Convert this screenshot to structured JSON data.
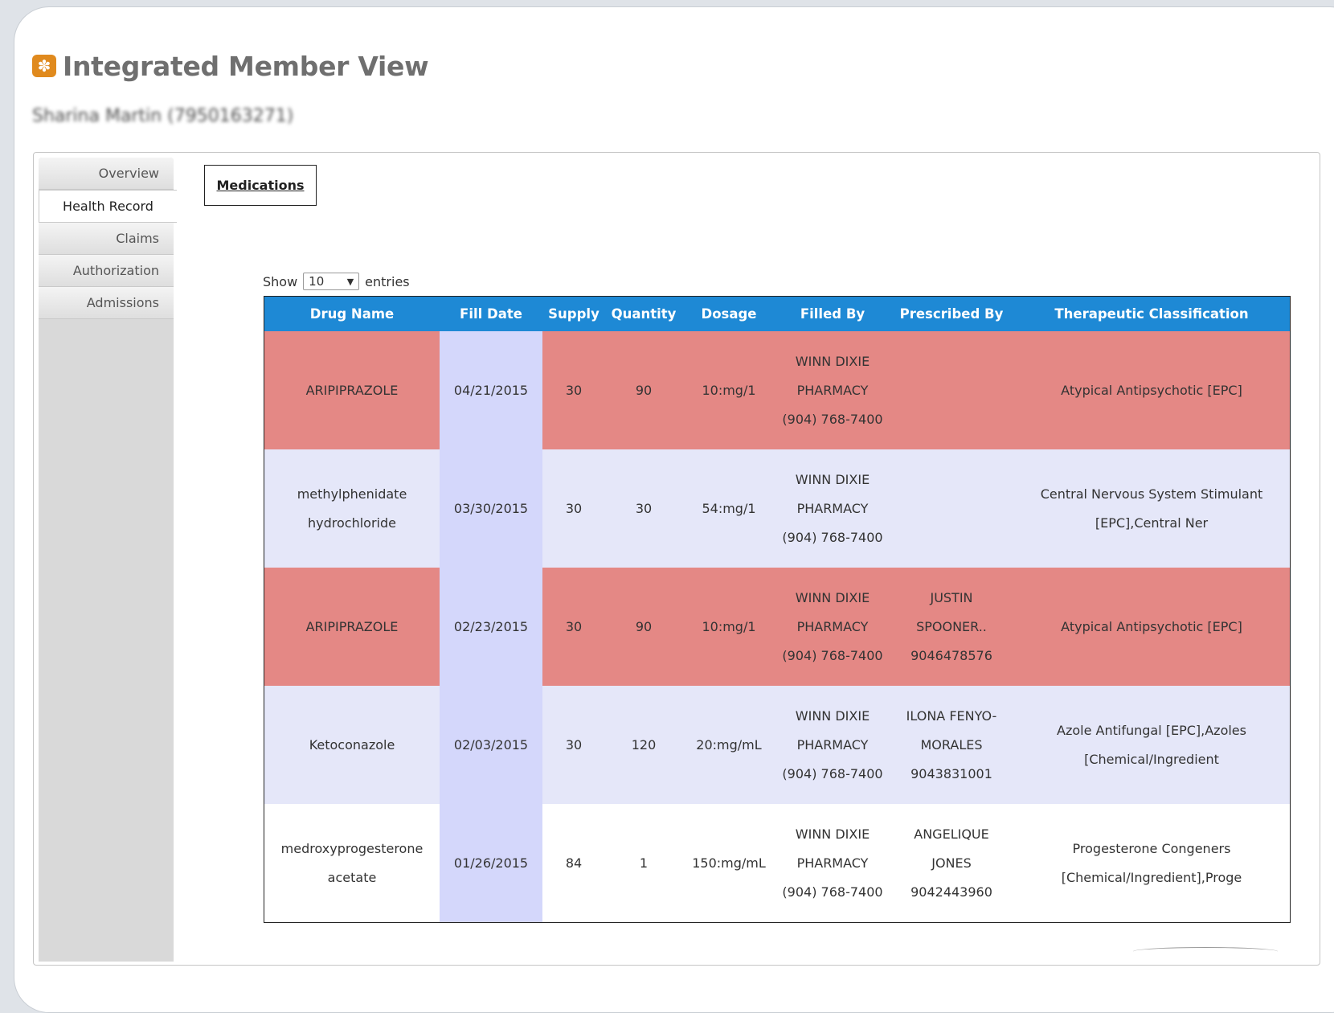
{
  "app": {
    "title": "Integrated Member View",
    "member_name": "Sharina Martin (7950163271)"
  },
  "sidebar": {
    "items": [
      {
        "label": "Overview"
      },
      {
        "label": "Health Record"
      },
      {
        "label": "Claims"
      },
      {
        "label": "Authorization"
      },
      {
        "label": "Admissions"
      }
    ]
  },
  "section": {
    "tab_label": "Medications"
  },
  "entries": {
    "show_label": "Show",
    "value": "10",
    "suffix": "entries"
  },
  "table": {
    "headers": [
      "Drug Name",
      "Fill Date",
      "Supply",
      "Quantity",
      "Dosage",
      "Filled By",
      "Prescribed By",
      "Therapeutic Classification"
    ],
    "rows": [
      {
        "drug": "ARIPIPRAZOLE",
        "fill_date": "04/21/2015",
        "supply": "30",
        "quantity": "90",
        "dosage": "10:mg/1",
        "filled_by": "WINN DIXIE PHARMACY (904) 768-7400",
        "prescribed_by": "",
        "classification": "Atypical Antipsychotic [EPC]"
      },
      {
        "drug": "methylphenidate hydrochloride",
        "fill_date": "03/30/2015",
        "supply": "30",
        "quantity": "30",
        "dosage": "54:mg/1",
        "filled_by": "WINN DIXIE PHARMACY (904) 768-7400",
        "prescribed_by": "",
        "classification": "Central Nervous System Stimulant [EPC],Central Ner"
      },
      {
        "drug": "ARIPIPRAZOLE",
        "fill_date": "02/23/2015",
        "supply": "30",
        "quantity": "90",
        "dosage": "10:mg/1",
        "filled_by": "WINN DIXIE PHARMACY (904) 768-7400",
        "prescribed_by": "JUSTIN SPOONER.. 9046478576",
        "classification": "Atypical Antipsychotic [EPC]"
      },
      {
        "drug": "Ketoconazole",
        "fill_date": "02/03/2015",
        "supply": "30",
        "quantity": "120",
        "dosage": "20:mg/mL",
        "filled_by": "WINN DIXIE PHARMACY (904) 768-7400",
        "prescribed_by": "ILONA FENYO-MORALES 9043831001",
        "classification": "Azole Antifungal [EPC],Azoles [Chemical/Ingredient"
      },
      {
        "drug": "medroxyprogesterone acetate",
        "fill_date": "01/26/2015",
        "supply": "84",
        "quantity": "1",
        "dosage": "150:mg/mL",
        "filled_by": "WINN DIXIE PHARMACY (904) 768-7400",
        "prescribed_by": "ANGELIQUE JONES 9042443960",
        "classification": "Progesterone Congeners [Chemical/Ingredient],Proge"
      }
    ]
  },
  "colors": {
    "header": "#1e89d5",
    "alert_row": "#e48885",
    "even_row": "#e5e7f9",
    "sorted_col": "#d4d7fb",
    "logo": "#e08a1e"
  }
}
